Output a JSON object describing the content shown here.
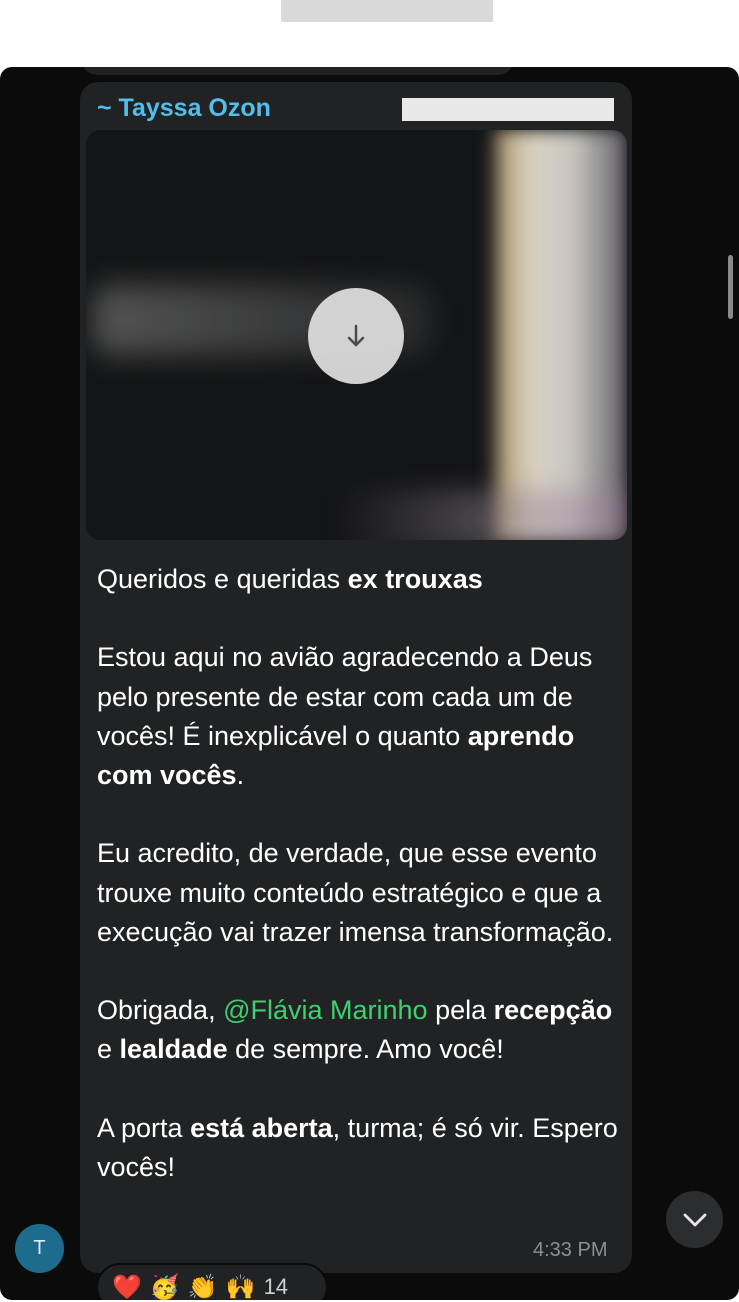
{
  "message": {
    "sender": "~ Tayssa Ozon",
    "paragraphs": {
      "p1": {
        "a": "Queridos e queridas ",
        "b": "ex trouxas"
      },
      "p2": {
        "a": "Estou aqui no avião agradecendo a Deus pelo presente de estar com cada um de vocês! É inexplicável o quanto ",
        "b": "aprendo com vocês",
        "c": "."
      },
      "p3": {
        "a": "Eu acredito, de verdade, que esse evento trouxe muito conteúdo estratégico e que a execução vai trazer imensa transformação."
      },
      "p4": {
        "a": "Obrigada, ",
        "mention": "@Flávia Marinho",
        "b": " pela ",
        "c": "recepção",
        "d": " e ",
        "e": "lealdade",
        "f": " de sempre. Amo você!"
      },
      "p5": {
        "a": "A porta ",
        "b": "está aberta",
        "c": ", turma; é só vir. Espero vocês!"
      }
    },
    "time": "4:33 PM"
  },
  "avatar": {
    "initial": "T"
  },
  "reactions": {
    "emojis": [
      "❤️",
      "🥳",
      "👏",
      "🙌"
    ],
    "count": "14"
  },
  "icons": {
    "download": "download-arrow-icon",
    "scroll_down": "chevron-down-icon"
  },
  "colors": {
    "sender": "#53bdeb",
    "mention": "#3fd170",
    "bubble": "#202223",
    "background": "#0b0b0b"
  }
}
